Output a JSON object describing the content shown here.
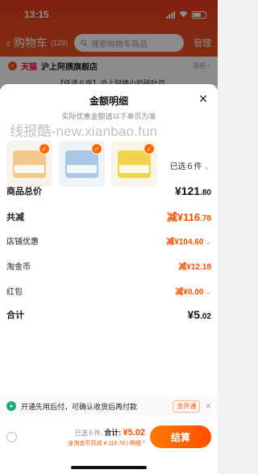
{
  "status": {
    "time": "13:15"
  },
  "nav": {
    "back": "‹",
    "title": "购物车",
    "count": "(129)",
    "search_placeholder": "搜索购物车商品",
    "manage": "管理"
  },
  "store": {
    "badge": "天猫",
    "name": "沪上阿姨旗舰店",
    "right": "领券 ›",
    "promo": "【任选６件】沪上阿姨小奶砖吐司"
  },
  "sheet": {
    "title": "金额明细",
    "subtitle": "实际优惠金额请以下单页为准",
    "close": "✕"
  },
  "watermark": "线报酷-new.xianbao.fun",
  "products_selected": "已选６件",
  "rows": {
    "total_price": {
      "label": "商品总价",
      "symbol": "¥",
      "int": "121",
      "dec": ".80"
    },
    "total_off": {
      "label": "共减",
      "prefix": "减¥",
      "int": "116",
      "dec": ".78"
    },
    "store_discount": {
      "label": "店铺优惠",
      "value": "减¥104.60"
    },
    "taojinbi": {
      "label": "淘金币",
      "value": "减¥12.18"
    },
    "hongbao": {
      "label": "红包",
      "value": "减¥0.00"
    },
    "sum": {
      "label": "合计",
      "symbol": "¥",
      "int": "5",
      "dec": ".02"
    }
  },
  "pay_later": {
    "text": "开通先用后付，可确认收货后再付款",
    "button": "去开通",
    "close": "✕"
  },
  "bottom": {
    "selected": "已选６件,",
    "total_label": "合计:",
    "total_value": "¥5.02",
    "detail": "含淘金币共减 ¥ 116.78 | 明细 ^",
    "checkout": "结算"
  },
  "colors": {
    "accent": "#ff5000",
    "header": "#e83a1f"
  }
}
